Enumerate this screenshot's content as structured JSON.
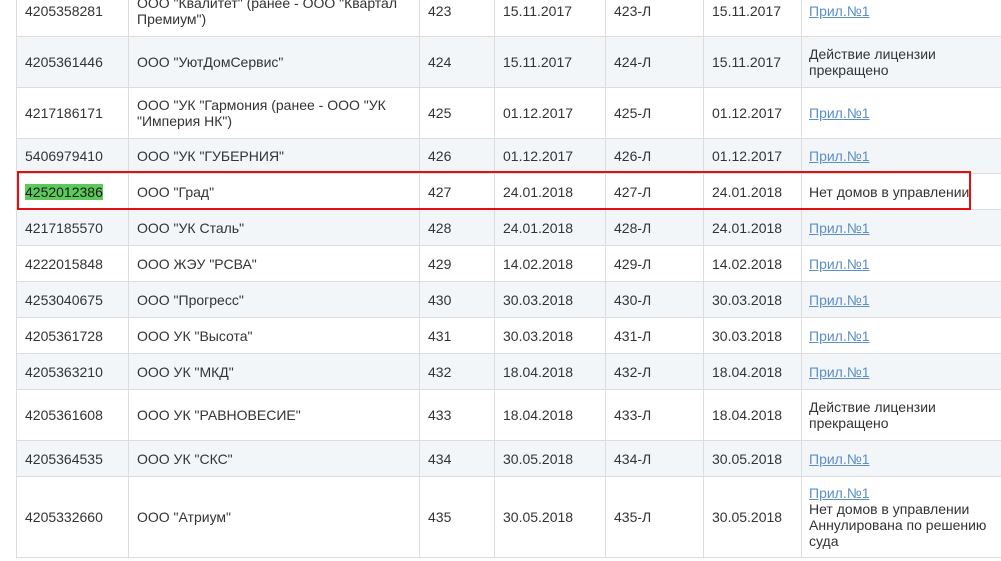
{
  "rows": [
    {
      "inn": "4205358281",
      "name": "ООО \"Квалитет\" (ранее - ООО \"Квартал Премиум\")",
      "num": "423",
      "date": "15.11.2017",
      "license": "423-Л",
      "date2": "15.11.2017",
      "note_link": "Прил.№1",
      "note_lines": []
    },
    {
      "inn": "4205361446",
      "name": "ООО \"УютДомСервис\"",
      "num": "424",
      "date": "15.11.2017",
      "license": "424-Л",
      "date2": "15.11.2017",
      "note_link": "",
      "note_lines": [
        "Действие лицензии",
        "прекращено"
      ]
    },
    {
      "inn": "4217186171",
      "name": "ООО \"УК \"Гармония (ранее - ООО \"УК \"Империя НК\")",
      "num": "425",
      "date": "01.12.2017",
      "license": "425-Л",
      "date2": "01.12.2017",
      "note_link": "Прил.№1",
      "note_lines": []
    },
    {
      "inn": "5406979410",
      "name": "ООО \"УК \"ГУБЕРНИЯ\"",
      "num": "426",
      "date": "01.12.2017",
      "license": "426-Л",
      "date2": "01.12.2017",
      "note_link": "Прил.№1",
      "note_lines": []
    },
    {
      "inn": "4252012386",
      "name": "ООО \"Град\"",
      "num": "427",
      "date": "24.01.2018",
      "license": "427-Л",
      "date2": "24.01.2018",
      "note_link": "",
      "note_lines": [
        "Нет домов в управлении"
      ]
    },
    {
      "inn": "4217185570",
      "name": "ООО \"УК Сталь\"",
      "num": "428",
      "date": "24.01.2018",
      "license": "428-Л",
      "date2": "24.01.2018",
      "note_link": "Прил.№1",
      "note_lines": []
    },
    {
      "inn": "4222015848",
      "name": "ООО ЖЭУ \"РСВА\"",
      "num": "429",
      "date": "14.02.2018",
      "license": "429-Л",
      "date2": "14.02.2018",
      "note_link": "Прил.№1",
      "note_lines": []
    },
    {
      "inn": "4253040675",
      "name": "ООО \"Прогресс\"",
      "num": "430",
      "date": "30.03.2018",
      "license": "430-Л",
      "date2": "30.03.2018",
      "note_link": "Прил.№1",
      "note_lines": []
    },
    {
      "inn": "4205361728",
      "name": "ООО УК \"Высота\"",
      "num": "431",
      "date": "30.03.2018",
      "license": "431-Л",
      "date2": "30.03.2018",
      "note_link": "Прил.№1",
      "note_lines": []
    },
    {
      "inn": "4205363210",
      "name": "ООО УК \"МКД\"",
      "num": "432",
      "date": "18.04.2018",
      "license": "432-Л",
      "date2": "18.04.2018",
      "note_link": "Прил.№1",
      "note_lines": []
    },
    {
      "inn": "4205361608",
      "name": "ООО УК \"РАВНОВЕСИЕ\"",
      "num": "433",
      "date": "18.04.2018",
      "license": "433-Л",
      "date2": "18.04.2018",
      "note_link": "",
      "note_lines": [
        "Действие лицензии",
        "прекращено"
      ]
    },
    {
      "inn": "4205364535",
      "name": "ООО УК \"СКС\"",
      "num": "434",
      "date": "30.05.2018",
      "license": "434-Л",
      "date2": "30.05.2018",
      "note_link": "Прил.№1",
      "note_lines": []
    },
    {
      "inn": "4205332660",
      "name": "ООО \"Атриум\"",
      "num": "435",
      "date": "30.05.2018",
      "license": "435-Л",
      "date2": "30.05.2018",
      "note_link": "Прил.№1",
      "note_lines": [
        "Нет домов в управлении",
        "Аннулирована по решению",
        "суда"
      ]
    }
  ],
  "highlighted_row_index": 4,
  "colors": {
    "highlight_mark": "#5bc95b",
    "annotation_box": "#e01010",
    "link": "#5b8fc7",
    "row_alt": "#f3f6f9"
  }
}
